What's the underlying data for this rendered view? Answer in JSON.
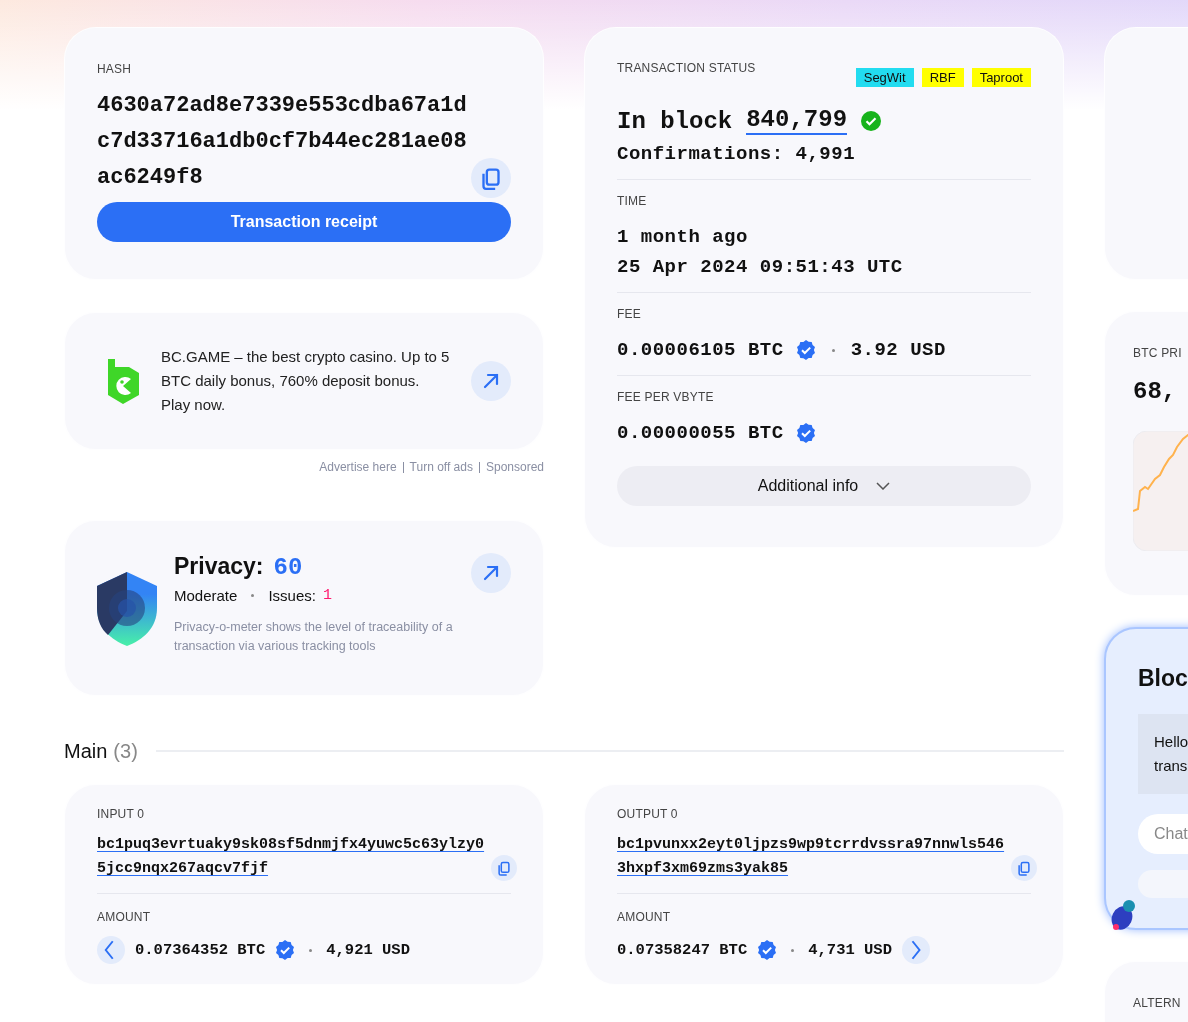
{
  "hash_card": {
    "label": "HASH",
    "hash": "4630a72ad8e7339e553cdba67a1dc7d33716a1db0cf7b44ec281ae08ac6249f8",
    "receipt_button": "Transaction receipt"
  },
  "ad": {
    "text": "BC.GAME – the best crypto casino. Up to 5 BTC daily bonus, 760% deposit bonus. Play now.",
    "links": [
      "Advertise here",
      "Turn off ads",
      "Sponsored"
    ]
  },
  "privacy": {
    "title": "Privacy:",
    "score": "60",
    "rating": "Moderate",
    "issues_label": "Issues:",
    "issues": "1",
    "description": "Privacy-o-meter shows the level of traceability of a transaction via various tracking tools"
  },
  "status": {
    "label": "TRANSACTION STATUS",
    "tags": [
      {
        "text": "SegWit",
        "color": "#22dcf0"
      },
      {
        "text": "RBF",
        "color": "#ffff00"
      },
      {
        "text": "Taproot",
        "color": "#ffff00"
      }
    ],
    "block_prefix": "In block",
    "block": "840,799",
    "confirmed": true,
    "confirmations": "Confirmations: 4,991",
    "time_label": "TIME",
    "time_relative": "1 month ago",
    "time_exact": "25 Apr 2024 09:51:43 UTC",
    "fee_label": "FEE",
    "fee_btc": "0.00006105 BTC",
    "fee_verified": true,
    "fee_usd": "3.92 USD",
    "fee_rate_label": "FEE PER VBYTE",
    "fee_rate": "0.00000055 BTC",
    "fee_rate_verified": true,
    "more_button": "Additional info"
  },
  "main": {
    "title": "Main",
    "count": "(3)",
    "io": [
      {
        "label": "INPUT 0",
        "address": "bc1puq3evrtuaky9sk08sf5dnmjfx4yuwc5c63ylzy05jcc9nqx267aqcv7fjf",
        "amount_label": "AMOUNT",
        "btc": "0.07364352 BTC",
        "verified": true,
        "usd": "4,921 USD",
        "kind": "input"
      },
      {
        "label": "OUTPUT 0",
        "address": "bc1pvunxx2eyt0ljpzs9wp9tcrrdvssra97nnwls5463hxpf3xm69zms3yak85",
        "amount_label": "AMOUNT",
        "btc": "0.07358247 BTC",
        "verified": true,
        "usd": "4,731 USD",
        "kind": "output"
      }
    ]
  },
  "side": {
    "price_label": "BTC PRI",
    "price": "68,",
    "chat_title": "Bloc",
    "chat_message": [
      "Hello",
      "trans"
    ],
    "chat_placeholder": "Chat",
    "alt_label": "ALTERN"
  }
}
